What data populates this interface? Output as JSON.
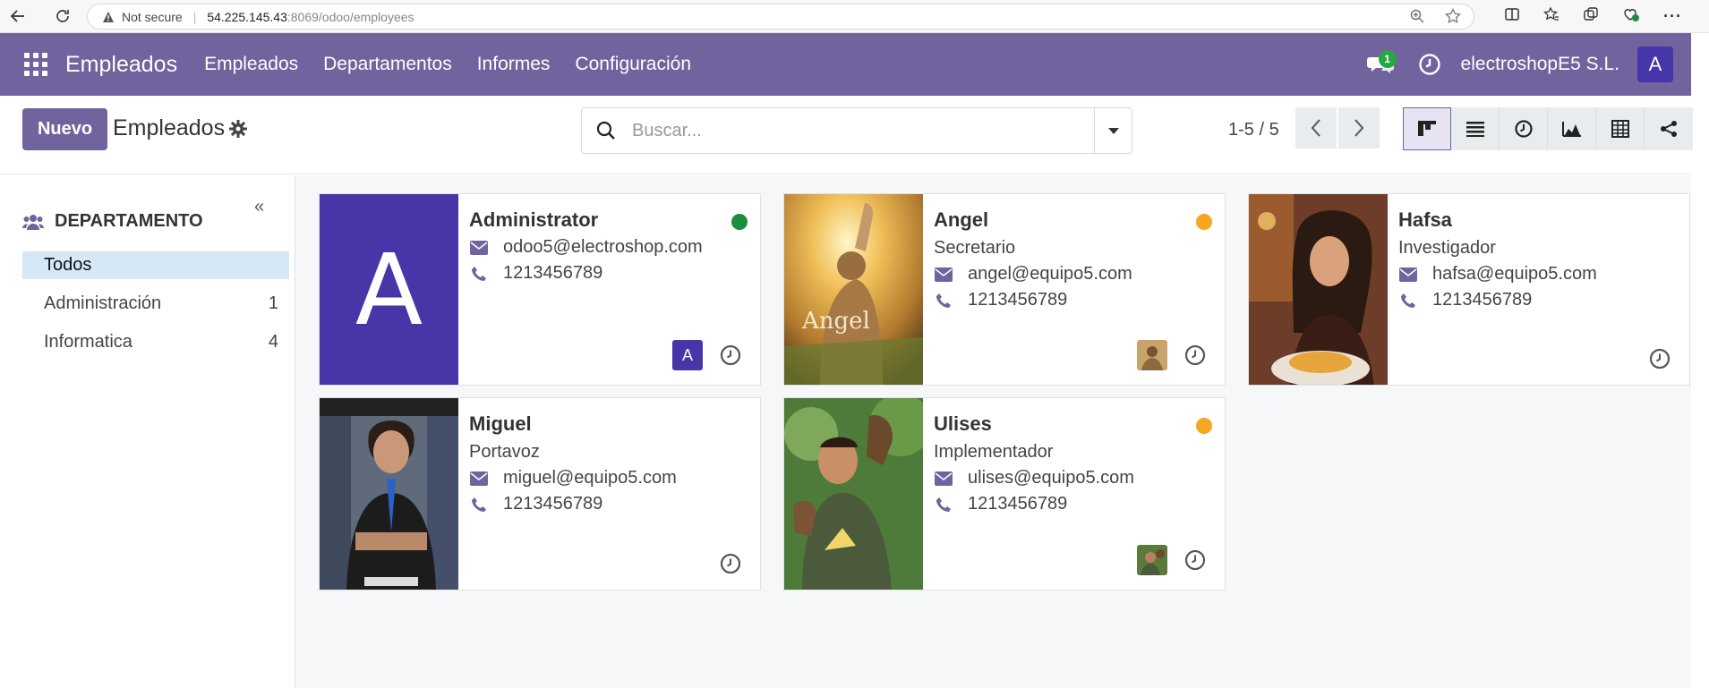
{
  "browser": {
    "not_secure": "Not secure",
    "url_host": "54.225.145.43",
    "url_rest": ":8069/odoo/employees"
  },
  "navbar": {
    "app_name": "Empleados",
    "menu": [
      "Empleados",
      "Departamentos",
      "Informes",
      "Configuración"
    ],
    "chat_badge": "1",
    "company": "electroshopE5 S.L.",
    "user_initial": "A"
  },
  "control": {
    "new_button": "Nuevo",
    "title": "Empleados",
    "search_placeholder": "Buscar...",
    "pager": "1-5 / 5"
  },
  "sidebar": {
    "heading": "DEPARTAMENTO",
    "items": [
      {
        "label": "Todos",
        "count": "",
        "active": true
      },
      {
        "label": "Administración",
        "count": "1",
        "active": false
      },
      {
        "label": "Informatica",
        "count": "4",
        "active": false
      }
    ]
  },
  "employees": [
    {
      "name": "Administrator",
      "job": "",
      "email": "odoo5@electroshop.com",
      "phone": "1213456789",
      "status": "#1e8e3e",
      "photo": "letter-A",
      "photo_letter": "A",
      "manager_initial": "A"
    },
    {
      "name": "Angel",
      "job": "Secretario",
      "email": "angel@equipo5.com",
      "phone": "1213456789",
      "status": "#f5a623",
      "photo": "man-raising-hand-sunlight",
      "photo_text": "Angel"
    },
    {
      "name": "Hafsa",
      "job": "Investigador",
      "email": "hafsa@equipo5.com",
      "phone": "1213456789",
      "status": "",
      "photo": "woman-eating-restaurant"
    },
    {
      "name": "Miguel",
      "job": "Portavoz",
      "email": "miguel@equipo5.com",
      "phone": "1213456789",
      "status": "",
      "photo": "man-in-sports-store"
    },
    {
      "name": "Ulises",
      "job": "Implementador",
      "email": "ulises@equipo5.com",
      "phone": "1213456789",
      "status": "#f5a623",
      "photo": "man-with-monkeys"
    }
  ],
  "colors": {
    "primary": "#71639e",
    "avatar": "#4636a7",
    "online": "#1e8e3e",
    "away": "#f5a623"
  }
}
